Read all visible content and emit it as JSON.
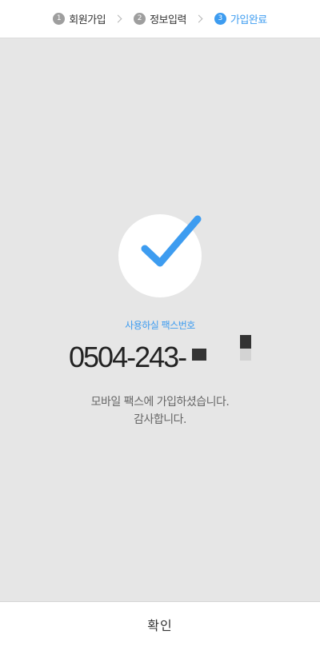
{
  "steps": [
    {
      "num": "1",
      "label": "회원가입",
      "active": false
    },
    {
      "num": "2",
      "label": "정보입력",
      "active": false
    },
    {
      "num": "3",
      "label": "가입완료",
      "active": true
    }
  ],
  "result": {
    "caption": "사용하실 팩스번호",
    "fax_number": "0504-243-",
    "message_line1": "모바일 팩스에 가입하셨습니다.",
    "message_line2": "감사합니다."
  },
  "confirm_label": "확인",
  "colors": {
    "accent": "#3d9cf0",
    "background": "#e6e6e6",
    "step_inactive": "#9e9e9e"
  },
  "icons": {
    "success": "check-icon",
    "step_separator": "chevron-right-icon"
  }
}
